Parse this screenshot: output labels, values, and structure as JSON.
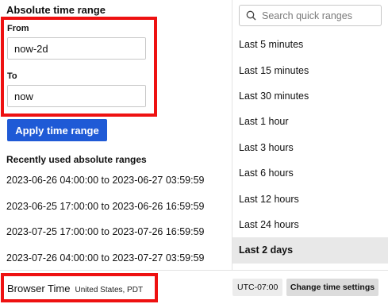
{
  "absolute": {
    "title": "Absolute time range",
    "from_label": "From",
    "from_value": "now-2d",
    "to_label": "To",
    "to_value": "now",
    "apply_label": "Apply time range"
  },
  "recent": {
    "title": "Recently used absolute ranges",
    "items": [
      "2023-06-26 04:00:00 to 2023-06-27 03:59:59",
      "2023-06-25 17:00:00 to 2023-06-26 16:59:59",
      "2023-07-25 17:00:00 to 2023-07-26 16:59:59",
      "2023-07-26 04:00:00 to 2023-07-27 03:59:59"
    ]
  },
  "quick": {
    "search_placeholder": "Search quick ranges",
    "items": [
      "Last 5 minutes",
      "Last 15 minutes",
      "Last 30 minutes",
      "Last 1 hour",
      "Last 3 hours",
      "Last 6 hours",
      "Last 12 hours",
      "Last 24 hours",
      "Last 2 days"
    ],
    "selected": "Last 2 days"
  },
  "footer": {
    "browser_time_label": "Browser Time",
    "location": "United States, PDT",
    "utc_offset": "UTC-07:00",
    "change_settings_label": "Change time settings"
  },
  "colors": {
    "highlight": "#ee1111",
    "apply_button": "#1f5ad6",
    "selected_row": "#e8e8e8"
  },
  "icons": {
    "calendar": "calendar-icon",
    "search": "search-icon"
  }
}
